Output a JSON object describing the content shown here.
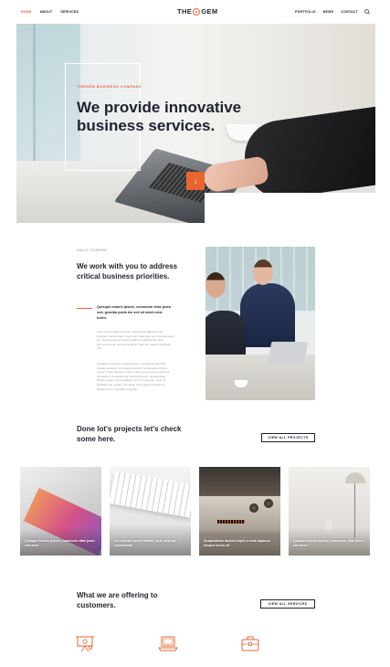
{
  "header": {
    "nav_left": [
      "HOME",
      "ABOUT",
      "SERVICES"
    ],
    "active_item": "HOME",
    "logo_left": "THE",
    "logo_right": "GEM",
    "nav_right": [
      "PORTFOLIO",
      "NEWS",
      "CONTACT"
    ],
    "search_icon": "search-icon"
  },
  "hero": {
    "eyebrow": "THEGEM BUSINESS COMPANY",
    "title": "We provide innovative business services.",
    "scroll_button_icon": "arrow-down-icon"
  },
  "about": {
    "eyebrow": "ABOUT COMPANY",
    "title": "We work with you to address critical business priorities.",
    "lead": "Quisque mauris ipsum, commodo vitae justo sed, gravida porta leo sed sit amet urna tortor.",
    "paragraph_1": "Lorem ipsum dolor sit amet, consectetur adipiscing elit. Quisque mauris ipsum, commodo vitae justo sed, gravida porta leo, sed sit amet urna tortor. Etiam eu ligula tortor. Sed fermentum erat, a porta est lacus. Nam non sapien dignissim nisi.",
    "paragraph_2": "Curabitur id semper molestie libero, non elementum felis. Aliquam at libero id tristique tincidunt. Suspendisse finibus neque in ante dapibus tempor. Lorem ipsum donec dictumst consequat, sit pulvinar elit. Sed id posuere. Suspendisse finibus neque in ante dapibus. Ut in consectetur, risus, id tincidunt erat, integer non amet, lorem ipsum ut tellus id, aliquam ac ex convallis ut feugiat."
  },
  "projects": {
    "title": "Done lot's projects let's check some here.",
    "view_all_label": "VIEW ALL PROJECTS",
    "cards": [
      {
        "caption": "Quisque mauris ipsum, commodo vitae justo sed amet"
      },
      {
        "caption": "Ut enim ad minim veniam, quis nostrud exercitation"
      },
      {
        "caption": "Suspendisse lacinia turpis in ante dapibus tempor lorem sit"
      },
      {
        "caption": "Quisque mauris ipsum, commodo vitae justo sed amet"
      }
    ]
  },
  "services": {
    "title": "What we are offering to customers.",
    "view_all_label": "VIEW ALL SERVICES",
    "icons": [
      "presentation-icon",
      "laptop-icon",
      "briefcase-icon"
    ]
  },
  "colors": {
    "accent": "#e8652f",
    "text_dark": "#1f2230",
    "text_muted": "#9a9aa2"
  }
}
